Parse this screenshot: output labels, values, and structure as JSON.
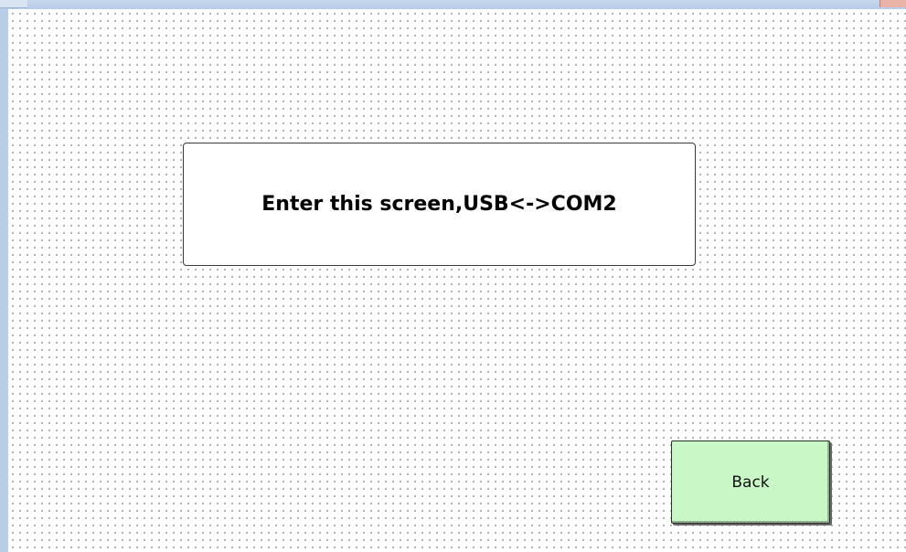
{
  "message": {
    "text": "Enter this screen,USB<->COM2"
  },
  "back_button": {
    "label": "Back",
    "color": "#c9f7c5"
  },
  "canvas": {
    "grid": "dotted"
  }
}
